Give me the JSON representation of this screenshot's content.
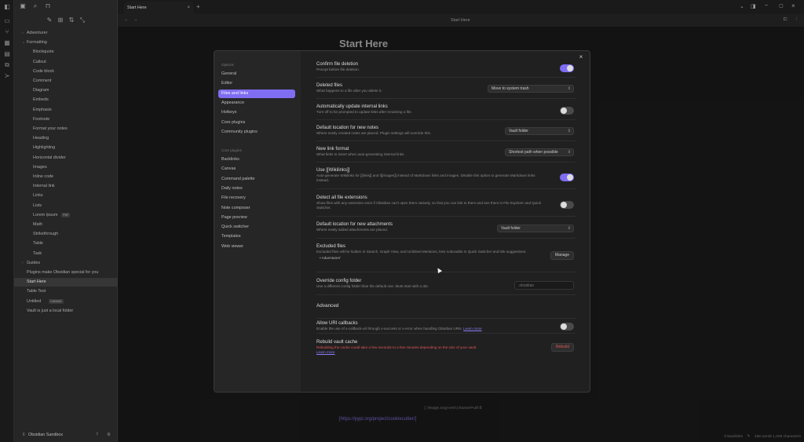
{
  "tab": {
    "title": "Start Here"
  },
  "navbar": {
    "title": "Start Here"
  },
  "note": {
    "heading": "Start Here",
    "image_label": "image.svg+xml;charset=utf-8",
    "link_text": "[https://pypi.org/project/cookiecutter/]"
  },
  "sidebar": {
    "items": [
      {
        "label": "Adventurer",
        "type": "folder",
        "level": 0
      },
      {
        "label": "Formatting",
        "type": "folder-open",
        "level": 0
      },
      {
        "label": "Blockquote",
        "level": 1
      },
      {
        "label": "Callout",
        "level": 1
      },
      {
        "label": "Code block",
        "level": 1
      },
      {
        "label": "Comment",
        "level": 1
      },
      {
        "label": "Diagram",
        "level": 1
      },
      {
        "label": "Embeds",
        "level": 1
      },
      {
        "label": "Emphasis",
        "level": 1
      },
      {
        "label": "Footnote",
        "level": 1
      },
      {
        "label": "Format your notes",
        "level": 1
      },
      {
        "label": "Heading",
        "level": 1
      },
      {
        "label": "Highlighting",
        "level": 1
      },
      {
        "label": "Horizontal divider",
        "level": 1
      },
      {
        "label": "Images",
        "level": 1
      },
      {
        "label": "Inline code",
        "level": 1
      },
      {
        "label": "Internal link",
        "level": 1
      },
      {
        "label": "Links",
        "level": 1
      },
      {
        "label": "Lists",
        "level": 1
      },
      {
        "label": "Lorem Ipsum",
        "level": 1,
        "badge": "PDF"
      },
      {
        "label": "Math",
        "level": 1
      },
      {
        "label": "Strikethrough",
        "level": 1
      },
      {
        "label": "Table",
        "level": 1
      },
      {
        "label": "Task",
        "level": 1
      },
      {
        "label": "Guides",
        "type": "folder",
        "level": 0
      },
      {
        "label": "Plugins make Obsidian special for you",
        "level": 0
      },
      {
        "label": "Start Here",
        "level": 0,
        "active": true
      },
      {
        "label": "Table Test",
        "level": 0
      },
      {
        "label": "Untitled",
        "level": 0,
        "badge": "CANVAS"
      },
      {
        "label": "Vault is just a local folder",
        "level": 0
      }
    ],
    "vault_name": "Obsidian Sandbox"
  },
  "modal": {
    "options_heading": "Options",
    "options": [
      "General",
      "Editor",
      "Files and links",
      "Appearance",
      "Hotkeys",
      "Core plugins",
      "Community plugins"
    ],
    "active_option": "Files and links",
    "core_heading": "Core plugins",
    "core_plugins": [
      "Backlinks",
      "Canvas",
      "Command palette",
      "Daily notes",
      "File recovery",
      "Note composer",
      "Page preview",
      "Quick switcher",
      "Templates",
      "Web viewer"
    ],
    "settings": {
      "confirm_delete": {
        "name": "Confirm file deletion",
        "desc": "Prompt before file deletion.",
        "enabled": true
      },
      "deleted_files": {
        "name": "Deleted files",
        "desc": "What happens to a file after you delete it.",
        "value": "Move to system trash"
      },
      "auto_update_links": {
        "name": "Automatically update internal links",
        "desc": "Turn off to be prompted to update links after renaming a file.",
        "enabled": false
      },
      "new_notes_location": {
        "name": "Default location for new notes",
        "desc": "Where newly created notes are placed. Plugin settings will override this.",
        "value": "Vault folder"
      },
      "link_format": {
        "name": "New link format",
        "desc": "What links to insert when auto-generating internal links.",
        "value": "Shortest path when possible"
      },
      "wikilinks": {
        "name": "Use [[Wikilinks]]",
        "desc": "Auto-generate Wikilinks for [[links]] and ![[images]] instead of Markdown links and images. Disable this option to generate Markdown links instead.",
        "enabled": true
      },
      "detect_extensions": {
        "name": "Detect all file extensions",
        "desc": "Show files with any extension even if Obsidian can't open them natively, so that you can link to them and see them in File Explorer and Quick Switcher.",
        "enabled": false
      },
      "attachments_location": {
        "name": "Default location for new attachments",
        "desc": "Where newly added attachments are placed.",
        "value": "Vault folder"
      },
      "excluded_files": {
        "name": "Excluded files",
        "desc": "Excluded files will be hidden in Search, Graph View, and Unlinked Mentions, less noticeable in Quick Switcher and link suggestions.",
        "button": "Manage",
        "entry": "Adventurer/"
      },
      "config_folder": {
        "name": "Override config folder",
        "desc": "Use a different config folder than the default one. Must start with a dot.",
        "placeholder": ".obsidian"
      },
      "advanced_heading": "Advanced",
      "uri_callbacks": {
        "name": "Allow URI callbacks",
        "desc": "Enable the use of x-callback-url through x-success or x-error when handling Obsidian URIs.",
        "link": "Learn more",
        "enabled": false
      },
      "rebuild_cache": {
        "name": "Rebuild vault cache",
        "desc": "Rebuilding the cache could take a few seconds to a few minutes depending on the size of your vault.",
        "link": "Learn more",
        "button": "Rebuild"
      }
    }
  },
  "status": {
    "backlinks": "0 backlinks",
    "counts": "158 words  1,029 characters"
  },
  "colors": {
    "accent": "#7f6df2",
    "warning": "#e0555a"
  }
}
